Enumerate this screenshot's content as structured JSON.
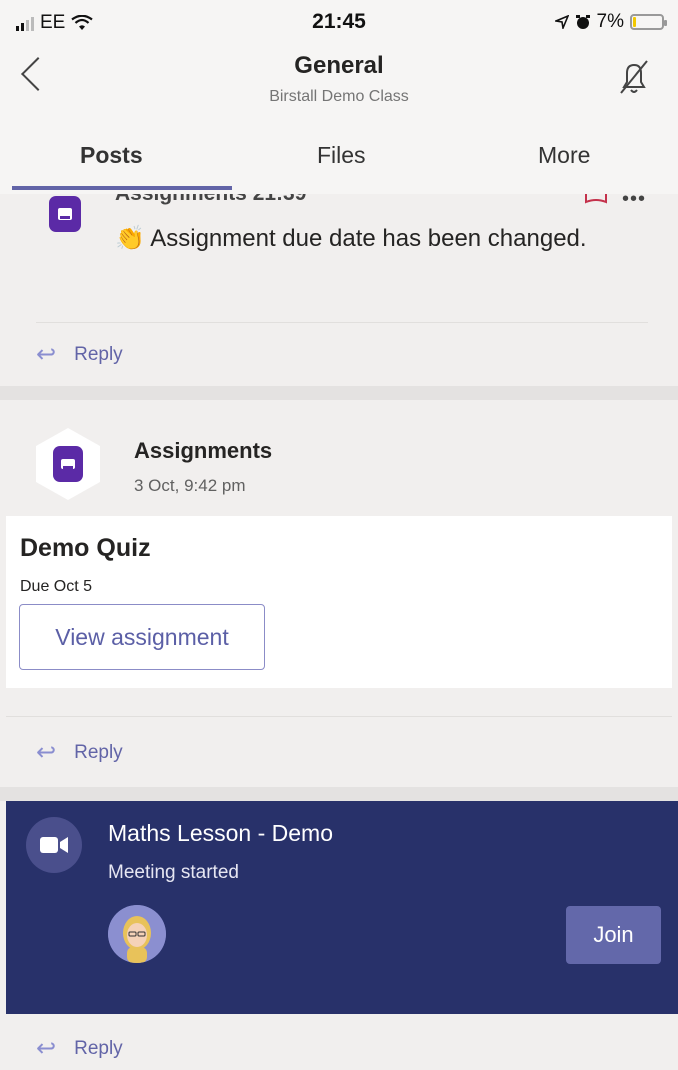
{
  "status_bar": {
    "carrier": "EE",
    "time": "21:45",
    "battery": "7%",
    "battery_level": 0.07
  },
  "header": {
    "title": "General",
    "subtitle": "Birstall Demo Class",
    "icons": {
      "back": "chevron-left-icon",
      "mute": "bell-slash-icon"
    }
  },
  "tabs": [
    {
      "label": "Posts",
      "active": true
    },
    {
      "label": "Files",
      "active": false
    },
    {
      "label": "More",
      "active": false
    }
  ],
  "posts": [
    {
      "author_partial": "Assignments 21:39",
      "message": "Assignment due date has been changed.",
      "emoji": "👏",
      "reply_label": "Reply"
    },
    {
      "author": "Assignments",
      "timestamp": "3 Oct, 9:42 pm",
      "assignment": {
        "title": "Demo Quiz",
        "due": "Due Oct 5",
        "button_label": "View assignment"
      },
      "reply_label": "Reply"
    },
    {
      "meeting": {
        "title": "Maths Lesson - Demo",
        "status": "Meeting started",
        "join_label": "Join"
      },
      "reply_label": "Reply"
    }
  ],
  "colors": {
    "accent": "#6264a7",
    "meeting_bg": "#28316a",
    "join_button": "#6368aa",
    "assignment_icon": "#5b2aa6"
  }
}
